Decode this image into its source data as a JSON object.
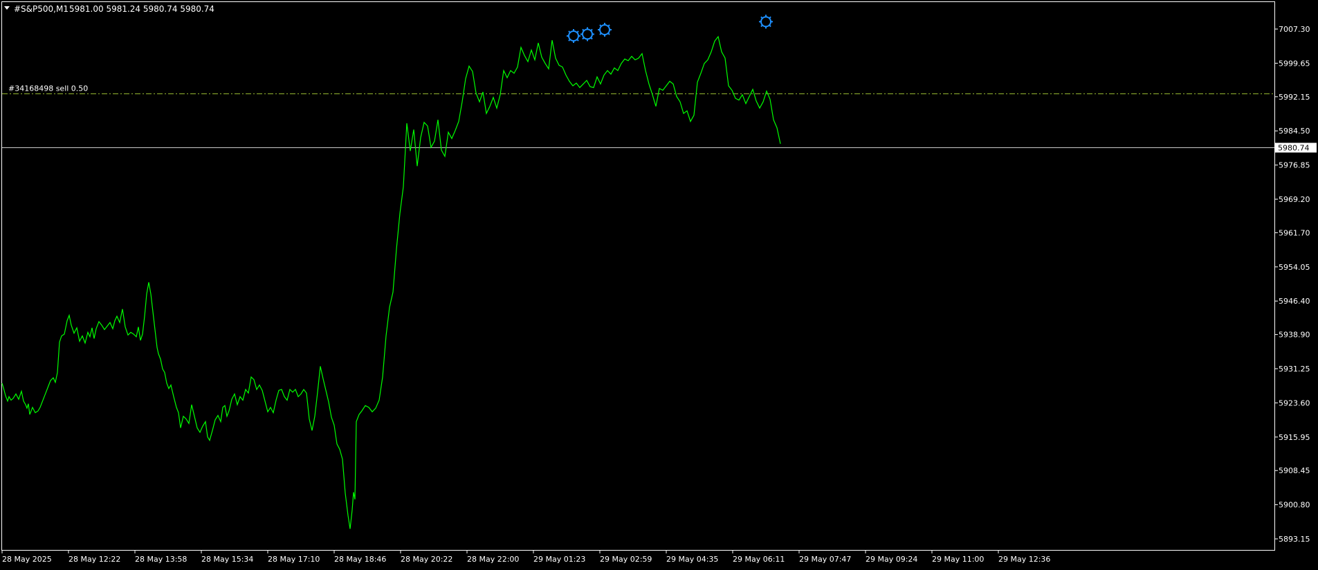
{
  "header": {
    "collapse_icon": "triangle-down-icon",
    "symbol": "#S&P500,M1",
    "ohlc": "5981.00 5981.24 5980.74 5980.74"
  },
  "order_label": "#34168498 sell 0.50",
  "current_price_label": "5980.74",
  "colors": {
    "background": "#000000",
    "series": "#00ff00",
    "grid_frame": "#ffffff",
    "order_line": "#99bb33",
    "marker": "#1e90ff",
    "text": "#ffffff",
    "price_box_bg": "#ffffff",
    "price_box_text": "#000000"
  },
  "chart_data": {
    "type": "line",
    "symbol": "#S&P500",
    "timeframe": "M1",
    "x_tick_labels": [
      "28 May 2025",
      "28 May 12:22",
      "28 May 13:58",
      "28 May 15:34",
      "28 May 17:10",
      "28 May 18:46",
      "28 May 20:22",
      "28 May 22:00",
      "29 May 01:23",
      "29 May 02:59",
      "29 May 04:35",
      "29 May 06:11",
      "29 May 07:47",
      "29 May 09:24",
      "29 May 11:00",
      "29 May 12:36"
    ],
    "y_tick_labels": [
      "7007.30",
      "5999.65",
      "5992.15",
      "5984.50",
      "5976.85",
      "5969.20",
      "5961.70",
      "5954.05",
      "5946.40",
      "5938.90",
      "5931.25",
      "5923.60",
      "5915.95",
      "5908.45",
      "5900.80",
      "5893.15"
    ],
    "y_tick_values": [
      6007.3,
      5999.65,
      5992.15,
      5984.5,
      5976.85,
      5969.2,
      5961.7,
      5954.05,
      5946.4,
      5938.9,
      5931.25,
      5923.6,
      5915.95,
      5908.45,
      5900.8,
      5893.15
    ],
    "ylim": [
      5890.0,
      6013.0
    ],
    "grid": false,
    "current_price": 5980.74,
    "order_level": 5992.8,
    "series": [
      {
        "x_index": [
          0,
          2,
          5,
          8,
          10,
          13,
          16,
          20,
          24,
          28,
          31,
          34,
          36,
          38,
          40,
          44,
          48,
          52,
          55,
          58,
          62,
          66,
          70,
          74,
          77,
          80,
          83,
          86,
          90,
          94,
          97,
          100,
          104,
          108,
          112,
          116,
          120,
          124,
          127,
          130,
          133,
          136,
          140,
          144,
          148,
          152,
          156,
          160,
          163,
          166,
          170,
          174,
          178,
          182,
          186,
          190,
          194,
          197,
          200,
          203,
          206,
          209,
          212,
          215,
          218,
          221,
          224,
          226,
          229,
          232,
          235,
          238,
          241,
          244,
          248,
          252,
          255,
          258,
          262,
          266,
          270,
          274,
          278,
          282,
          286,
          290,
          294,
          297,
          300,
          304,
          308,
          312,
          316,
          319,
          322,
          325,
          328,
          332,
          336,
          340,
          344,
          348,
          352,
          356,
          360,
          364,
          368,
          372,
          376,
          380,
          384,
          388,
          392,
          396,
          400,
          404,
          408,
          412,
          416,
          420,
          424,
          428,
          432,
          436,
          440,
          444,
          448,
          452,
          456,
          460,
          464,
          468,
          472,
          476,
          480,
          484,
          488,
          492,
          496,
          500,
          503,
          506,
          508,
          510,
          512,
          516,
          520,
          525,
          530,
          535,
          540,
          545,
          550,
          555,
          560,
          565,
          570,
          575,
          580,
          585,
          590,
          595,
          600,
          605,
          610,
          615,
          620,
          625,
          630,
          635,
          640,
          645,
          650,
          655,
          660,
          665,
          670,
          675,
          680,
          685,
          690,
          695,
          700,
          705,
          710,
          715,
          720,
          725,
          730,
          735,
          740,
          745,
          750,
          755,
          760,
          765,
          770,
          775,
          780,
          785,
          790,
          795,
          800,
          805,
          810,
          815,
          820,
          825,
          830,
          835,
          840,
          845,
          850,
          855,
          860,
          865,
          870,
          875,
          880,
          885,
          890,
          895,
          900,
          905,
          910,
          915,
          920,
          925,
          930,
          935,
          940,
          945,
          950,
          955,
          960,
          965,
          970,
          975,
          980,
          985,
          990,
          995,
          1000,
          1005,
          1010,
          1015,
          1020,
          1025,
          1030,
          1035,
          1040,
          1045,
          1050,
          1055,
          1060,
          1065,
          1070,
          1075,
          1080,
          1085,
          1090,
          1095,
          1100,
          1105,
          1110,
          1115,
          1120,
          1125,
          1130,
          1135,
          1140,
          1145,
          1150,
          1155,
          1160,
          1165,
          1170,
          1175,
          1180,
          1185,
          1190,
          1195,
          1200,
          1205,
          1210
        ],
        "values": [
          5928.0,
          5927.0,
          5925.2,
          5924.0,
          5925.0,
          5924.2,
          5924.6,
          5925.6,
          5924.4,
          5926.2,
          5924.0,
          5923.2,
          5922.4,
          5923.4,
          5921.0,
          5922.6,
          5921.4,
          5921.8,
          5922.6,
          5923.8,
          5925.4,
          5927.0,
          5928.6,
          5929.2,
          5928.2,
          5930.4,
          5937.2,
          5938.6,
          5939.0,
          5942.0,
          5943.2,
          5941.0,
          5939.2,
          5940.4,
          5937.4,
          5938.6,
          5937.0,
          5939.4,
          5938.4,
          5940.4,
          5938.0,
          5940.2,
          5941.8,
          5941.0,
          5940.0,
          5940.8,
          5941.6,
          5940.2,
          5942.0,
          5943.0,
          5941.6,
          5944.6,
          5940.6,
          5938.8,
          5939.4,
          5939.0,
          5938.4,
          5940.6,
          5937.6,
          5939.0,
          5943.0,
          5948.0,
          5950.6,
          5948.0,
          5944.0,
          5940.0,
          5936.0,
          5934.6,
          5933.4,
          5931.2,
          5930.4,
          5928.0,
          5926.8,
          5927.6,
          5925.0,
          5922.6,
          5921.4,
          5918.0,
          5920.6,
          5920.0,
          5919.0,
          5923.2,
          5920.6,
          5918.0,
          5917.0,
          5918.4,
          5919.4,
          5916.0,
          5915.2,
          5917.4,
          5919.8,
          5920.8,
          5919.4,
          5922.6,
          5923.0,
          5920.6,
          5921.8,
          5924.4,
          5925.6,
          5923.2,
          5925.0,
          5924.2,
          5926.6,
          5925.8,
          5929.4,
          5928.8,
          5926.6,
          5927.6,
          5926.4,
          5924.0,
          5921.6,
          5922.6,
          5921.4,
          5924.2,
          5926.4,
          5926.6,
          5925.0,
          5924.2,
          5926.6,
          5926.0,
          5926.6,
          5925.0,
          5925.6,
          5926.6,
          5925.8,
          5920.0,
          5917.4,
          5920.6,
          5926.0,
          5931.8,
          5929.0,
          5926.4,
          5923.8,
          5920.4,
          5918.6,
          5914.4,
          5913.2,
          5911.0,
          5903.4,
          5898.4,
          5895.4,
          5899.6,
          5903.6,
          5902.0,
          5919.4,
          5921.0,
          5921.8,
          5923.0,
          5922.6,
          5921.6,
          5922.4,
          5924.2,
          5929.4,
          5938.6,
          5945.0,
          5948.4,
          5958.0,
          5966.0,
          5972.0,
          5986.2,
          5980.0,
          5984.8,
          5976.6,
          5983.0,
          5986.4,
          5985.6,
          5980.8,
          5982.2,
          5987.0,
          5980.2,
          5978.8,
          5984.2,
          5982.8,
          5984.6,
          5986.6,
          5991.0,
          5996.2,
          5999.0,
          5997.8,
          5993.0,
          5991.0,
          5993.2,
          5988.4,
          5990.0,
          5992.0,
          5989.6,
          5992.6,
          5998.0,
          5996.4,
          5998.0,
          5997.4,
          5998.8,
          6003.2,
          6001.4,
          6000.0,
          6002.6,
          6000.4,
          6004.2,
          6001.0,
          5999.6,
          5998.4,
          6004.8,
          6000.8,
          5999.2,
          5998.8,
          5997.0,
          5995.6,
          5994.6,
          5995.2,
          5994.2,
          5995.0,
          5995.8,
          5994.4,
          5994.2,
          5996.6,
          5995.0,
          5997.0,
          5998.0,
          5997.2,
          5998.6,
          5998.0,
          5999.6,
          6000.6,
          6000.2,
          6001.2,
          6000.4,
          6000.8,
          6001.8,
          5998.0,
          5995.0,
          5992.6,
          5990.0,
          5994.0,
          5993.6,
          5994.6,
          5995.6,
          5995.0,
          5992.2,
          5991.0,
          5988.4,
          5989.0,
          5986.6,
          5988.0,
          5995.4,
          5997.4,
          5999.6,
          6000.4,
          6002.2,
          6004.6,
          6005.6,
          6002.2,
          6000.8,
          5994.6,
          5993.6,
          5991.8,
          5991.4,
          5992.6,
          5990.6,
          5992.2,
          5993.8,
          5991.2,
          5989.6,
          5991.0,
          5993.4,
          5991.6,
          5987.0,
          5985.2,
          5981.6
        ]
      }
    ],
    "markers": [
      {
        "name": "marker-1",
        "x_index": 826,
        "value": 6004.2
      },
      {
        "name": "marker-2",
        "x_index": 846,
        "value": 6004.6
      },
      {
        "name": "marker-3",
        "x_index": 871,
        "value": 6005.6
      },
      {
        "name": "marker-4",
        "x_index": 1104,
        "value": 6007.4
      }
    ]
  }
}
